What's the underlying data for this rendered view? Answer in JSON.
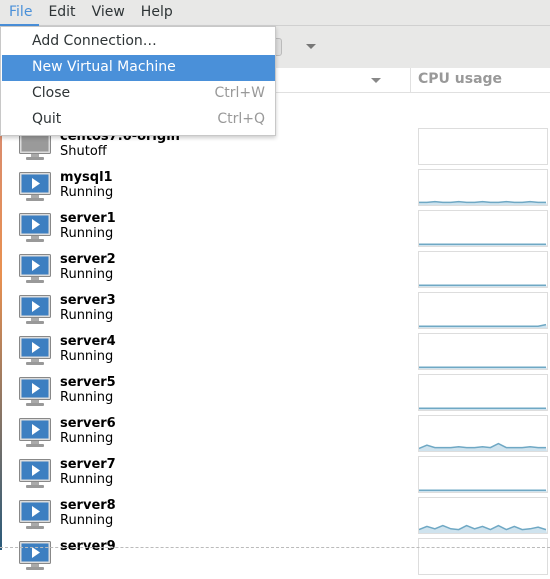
{
  "menubar": {
    "items": [
      "File",
      "Edit",
      "View",
      "Help"
    ],
    "active": "File"
  },
  "file_menu": {
    "items": [
      {
        "label": "Add Connection…",
        "shortcut": ""
      },
      {
        "label": "New Virtual Machine",
        "shortcut": "",
        "highlighted": true
      },
      {
        "label": "Close",
        "shortcut": "Ctrl+W"
      },
      {
        "label": "Quit",
        "shortcut": "Ctrl+Q"
      }
    ]
  },
  "columns": {
    "cpu": "CPU usage"
  },
  "colors": {
    "accent": "#4a90d9",
    "sparkline": "#6fa8c4",
    "running_screen": "#3d7fc1",
    "shutoff_screen": "#9a9a9a"
  },
  "vms": [
    {
      "name": "centos7.6-origin",
      "status": "Shutoff",
      "icon": "vm-shutoff-icon",
      "cpu_history": []
    },
    {
      "name": "mysql1",
      "status": "Running",
      "icon": "vm-running-icon",
      "cpu_history": [
        2,
        2,
        3,
        2,
        2,
        3,
        2,
        2,
        3,
        2,
        2,
        3,
        2,
        2,
        3,
        2,
        2
      ]
    },
    {
      "name": "server1",
      "status": "Running",
      "icon": "vm-running-icon",
      "cpu_history": [
        1,
        1,
        1,
        1,
        1,
        1,
        1,
        1,
        1,
        1,
        1,
        1,
        1,
        1,
        1,
        1,
        1
      ]
    },
    {
      "name": "server2",
      "status": "Running",
      "icon": "vm-running-icon",
      "cpu_history": [
        1,
        1,
        1,
        1,
        1,
        1,
        1,
        1,
        1,
        1,
        1,
        1,
        1,
        1,
        1,
        1,
        1
      ]
    },
    {
      "name": "server3",
      "status": "Running",
      "icon": "vm-running-icon",
      "cpu_history": [
        1,
        1,
        1,
        1,
        1,
        1,
        1,
        1,
        1,
        1,
        1,
        1,
        1,
        1,
        1,
        1,
        3
      ]
    },
    {
      "name": "server4",
      "status": "Running",
      "icon": "vm-running-icon",
      "cpu_history": [
        1,
        1,
        1,
        1,
        1,
        1,
        1,
        1,
        1,
        1,
        1,
        1,
        1,
        1,
        1,
        1,
        1
      ]
    },
    {
      "name": "server5",
      "status": "Running",
      "icon": "vm-running-icon",
      "cpu_history": [
        1,
        1,
        1,
        1,
        1,
        1,
        1,
        1,
        1,
        1,
        1,
        1,
        1,
        1,
        1,
        1,
        1
      ]
    },
    {
      "name": "server6",
      "status": "Running",
      "icon": "vm-running-icon",
      "cpu_history": [
        2,
        6,
        3,
        3,
        3,
        4,
        3,
        3,
        4,
        3,
        8,
        3,
        3,
        3,
        4,
        3,
        3
      ]
    },
    {
      "name": "server7",
      "status": "Running",
      "icon": "vm-running-icon",
      "cpu_history": [
        1,
        1,
        1,
        1,
        1,
        1,
        1,
        1,
        1,
        1,
        1,
        1,
        1,
        1,
        1,
        1,
        1
      ]
    },
    {
      "name": "server8",
      "status": "Running",
      "icon": "vm-running-icon",
      "cpu_history": [
        3,
        7,
        4,
        8,
        4,
        3,
        8,
        4,
        7,
        3,
        8,
        3,
        7,
        3,
        4,
        6,
        3
      ]
    },
    {
      "name": "server9",
      "status": "",
      "icon": "vm-running-icon",
      "cpu_history": []
    }
  ]
}
